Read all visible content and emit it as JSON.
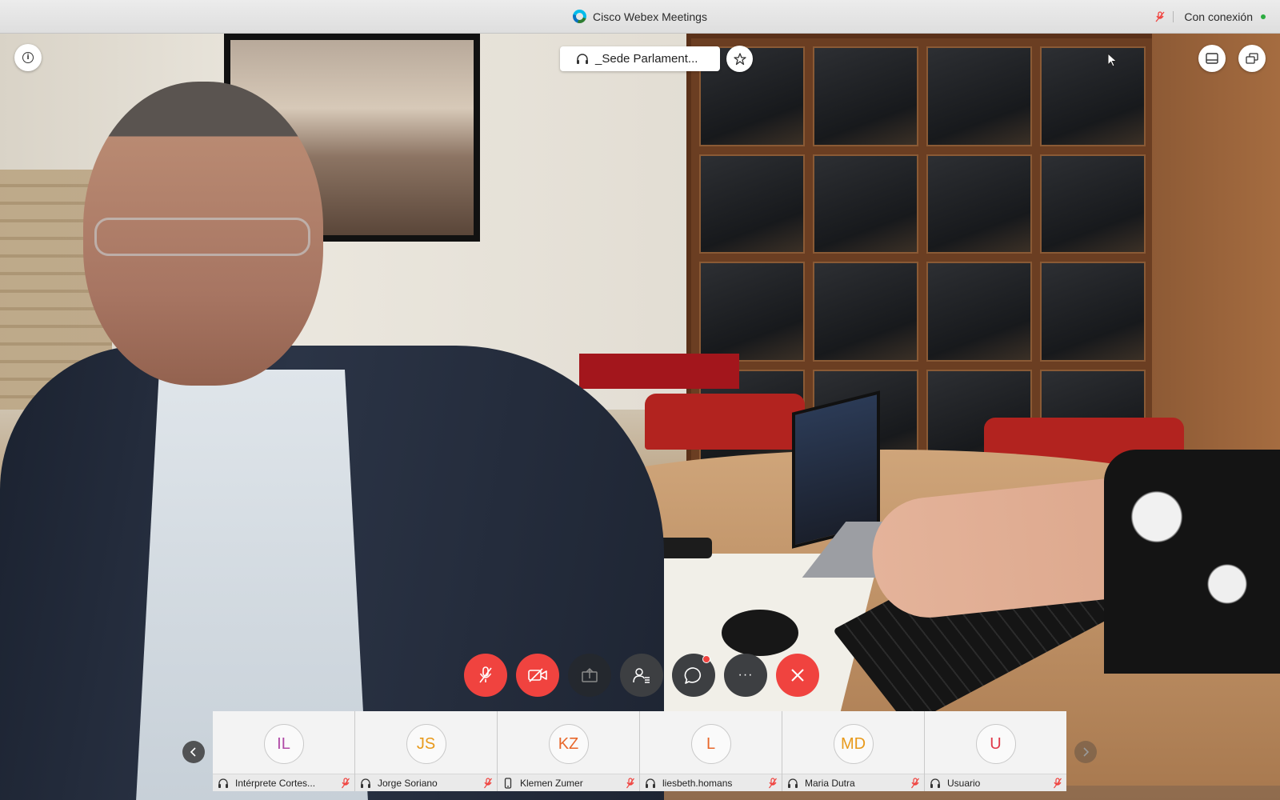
{
  "window": {
    "title": "Cisco Webex Meetings",
    "connection_status": "Con conexión",
    "logo_icon": "webex-logo-icon",
    "mic_status_icon": "mic-muted-icon"
  },
  "video": {
    "active_speaker": "_Sede Parlament..."
  },
  "overlay_icons": {
    "info": "info-icon",
    "pin": "pin-icon",
    "layout": "layout-icon",
    "popout": "popout-windows-icon"
  },
  "controls": [
    {
      "id": "mute",
      "icon": "mic-muted-icon",
      "state": "muted",
      "color": "#f0433f"
    },
    {
      "id": "video",
      "icon": "video-off-icon",
      "state": "off",
      "color": "#f0433f"
    },
    {
      "id": "share",
      "icon": "share-screen-icon",
      "state": "disabled"
    },
    {
      "id": "participants",
      "icon": "participants-icon"
    },
    {
      "id": "chat",
      "icon": "chat-icon",
      "notification": true
    },
    {
      "id": "more",
      "icon": "more-icon",
      "label": "···"
    },
    {
      "id": "leave",
      "icon": "close-icon",
      "color": "#f0433f"
    }
  ],
  "participants": [
    {
      "initials": "IL",
      "name": "Intérprete Cortes...",
      "device": "headset-icon",
      "color": "#b04aa6",
      "muted": true
    },
    {
      "initials": "JS",
      "name": "Jorge Soriano",
      "device": "headset-icon",
      "color": "#e89a1c",
      "muted": true
    },
    {
      "initials": "KZ",
      "name": "Klemen Zumer",
      "device": "phone-icon",
      "color": "#e8672a",
      "muted": true
    },
    {
      "initials": "L",
      "name": "liesbeth.homans",
      "device": "headset-icon",
      "color": "#e8672a",
      "muted": true
    },
    {
      "initials": "MD",
      "name": "Maria Dutra",
      "device": "headset-icon",
      "color": "#e89a1c",
      "muted": true
    },
    {
      "initials": "U",
      "name": "Usuario",
      "device": "headset-icon",
      "color": "#e0394a",
      "muted": true
    }
  ],
  "colors": {
    "accent_red": "#f0433f",
    "online_green": "#2bab3f"
  }
}
